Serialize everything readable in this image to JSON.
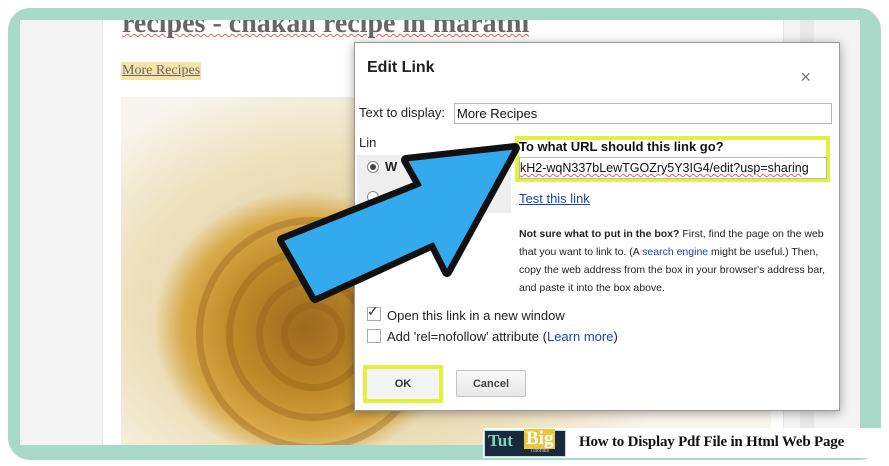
{
  "blog": {
    "post_title": "recipes - chakali recipe in marathi",
    "post_link": "More Recipes"
  },
  "dialog": {
    "title": "Edit Link",
    "close_glyph": "×",
    "text_to_display_label": "Text to display:",
    "text_to_display_value": "More Recipes",
    "link_to_label": "Lin",
    "radio_web_label": "W",
    "url_question": "To what URL should this link go?",
    "url_value": "kH2-wqN337bLewTGOZry5Y3IG4/edit?usp=sharing",
    "test_link": "Test this link",
    "help": {
      "bold": "Not sure what to put in the box?",
      "part1": " First, find the page on the web that you want to link to. (A ",
      "link": "search engine",
      "part2": " might be useful.) Then, copy the web address from the box in your browser's address bar, and paste it into the box above."
    },
    "open_new_window_label": "Open this link in a new window",
    "nofollow_label_before": "Add 'rel=nofollow' attribute (",
    "learn_more": "Learn more",
    "nofollow_label_after": ")",
    "ok_label": "OK",
    "cancel_label": "Cancel"
  },
  "banner": {
    "logo_part1": "Tut",
    "logo_part2": "Big",
    "logo_tagline": "Tutorials",
    "title": "How to Display Pdf File in Html Web Page"
  },
  "colors": {
    "frame": "#a9dac9",
    "highlight": "#e2f23c",
    "arrow_fill": "#33aaee",
    "link": "#1a44b8"
  }
}
